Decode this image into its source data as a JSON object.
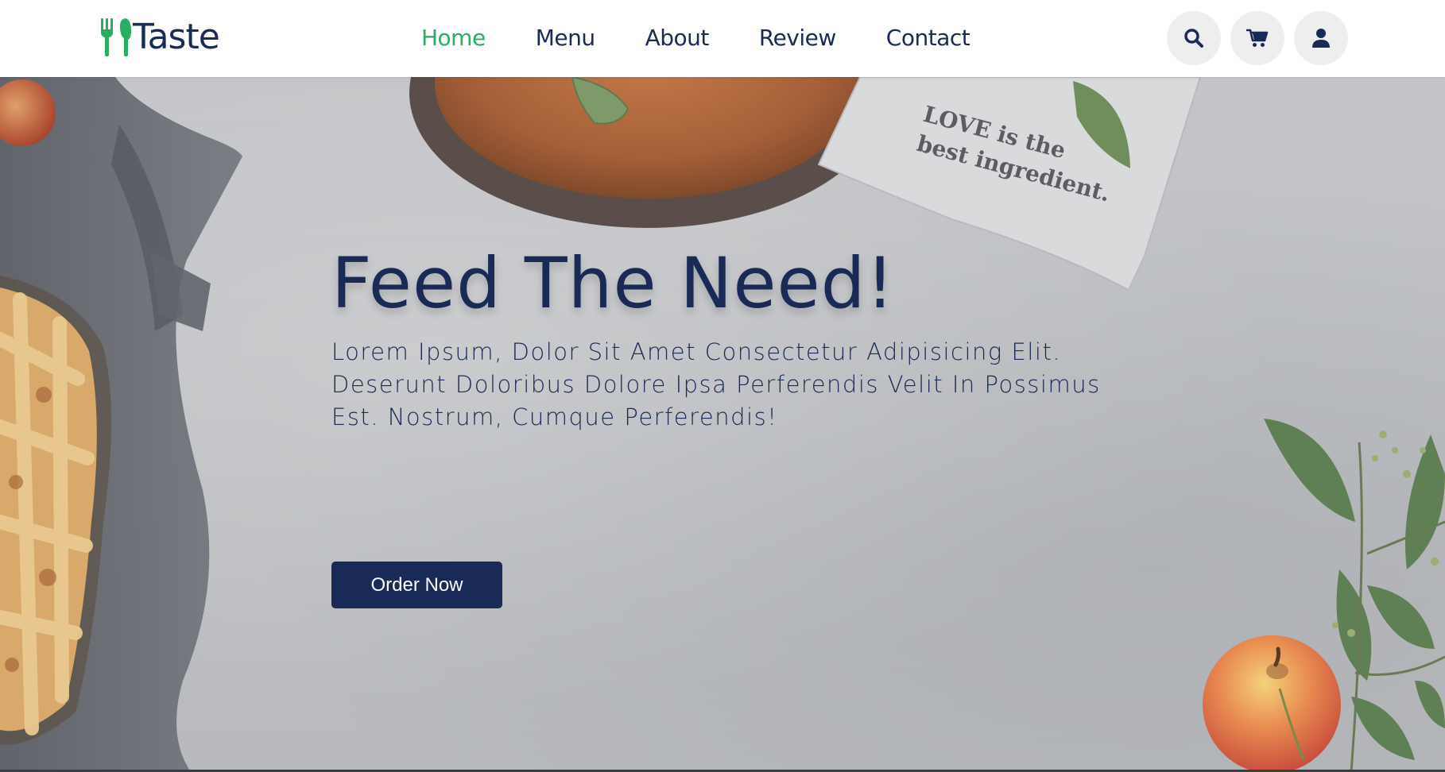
{
  "brand": {
    "name": "Taste",
    "accent": "#27ae60",
    "primary": "#192a56"
  },
  "nav": {
    "items": [
      {
        "label": "Home",
        "active": true
      },
      {
        "label": "Menu",
        "active": false
      },
      {
        "label": "About",
        "active": false
      },
      {
        "label": "Review",
        "active": false
      },
      {
        "label": "Contact",
        "active": false
      }
    ]
  },
  "header_icons": [
    "search-icon",
    "cart-icon",
    "user-icon"
  ],
  "hero": {
    "title": "Feed The Need!",
    "description": "Lorem Ipsum, Dolor Sit Amet Consectetur Adipisicing Elit. Deserunt Doloribus Dolore Ipsa Perferendis Velit In Possimus Est. Nostrum, Cumque Perferendis!",
    "button_label": "Order Now",
    "napkin_text": "LOVE is the best ingredient."
  }
}
